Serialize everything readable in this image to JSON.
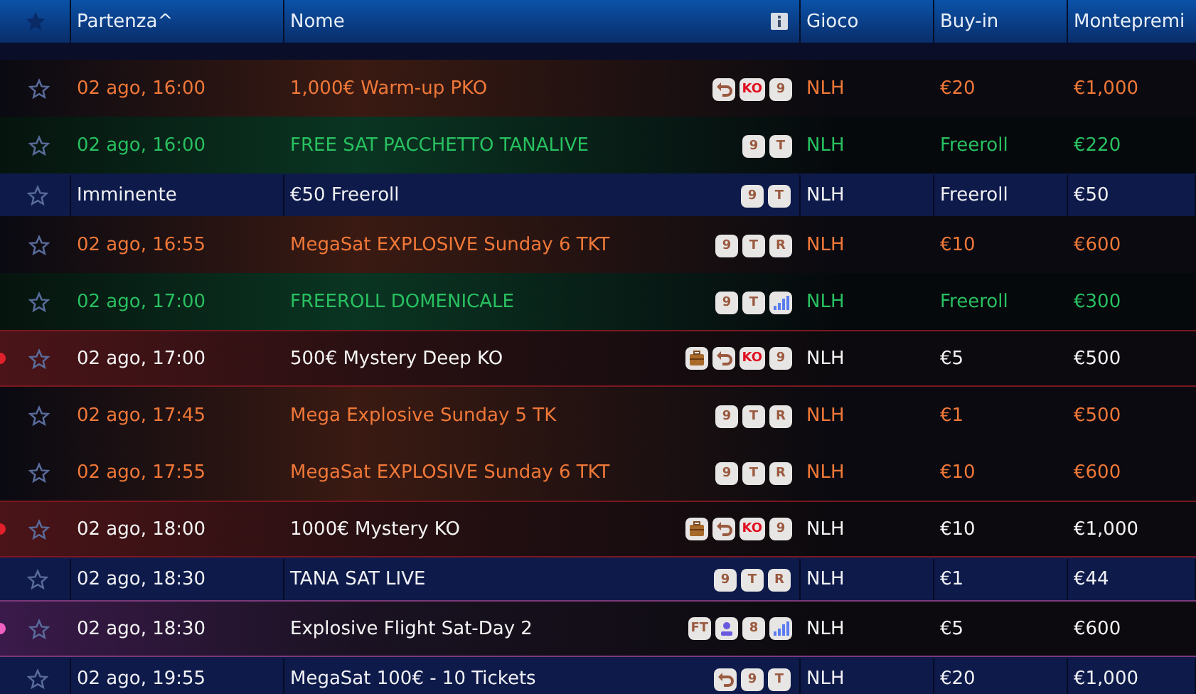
{
  "columns": [
    "Partenza^",
    "Nome",
    "Gioco",
    "Buy-in",
    "Montepremi"
  ],
  "rows": [
    {
      "kind": "orange",
      "start": "02 ago, 16:00",
      "name": "1,000€ Warm-up PKO",
      "badges": [
        {
          "kind": "rebuy"
        },
        {
          "kind": "ko",
          "label": "KO"
        },
        {
          "kind": "text",
          "label": "9"
        }
      ],
      "game": "NLH",
      "buyin": "€20",
      "prize": "€1,000"
    },
    {
      "kind": "green",
      "start": "02 ago, 16:00",
      "name": "FREE SAT PACCHETTO TANALIVE",
      "badges": [
        {
          "kind": "text",
          "label": "9"
        },
        {
          "kind": "text",
          "label": "T"
        }
      ],
      "game": "NLH",
      "buyin": "Freeroll",
      "prize": "€220"
    },
    {
      "kind": "plain",
      "start": "Imminente",
      "name": "€50 Freeroll",
      "badges": [
        {
          "kind": "text",
          "label": "9"
        },
        {
          "kind": "text",
          "label": "T"
        }
      ],
      "game": "NLH",
      "buyin": "Freeroll",
      "prize": "€50"
    },
    {
      "kind": "orange",
      "start": "02 ago, 16:55",
      "name": "MegaSat EXPLOSIVE Sunday 6 TKT",
      "badges": [
        {
          "kind": "text",
          "label": "9"
        },
        {
          "kind": "text",
          "label": "T"
        },
        {
          "kind": "text",
          "label": "R"
        }
      ],
      "game": "NLH",
      "buyin": "€10",
      "prize": "€600"
    },
    {
      "kind": "green",
      "start": "02 ago, 17:00",
      "name": "FREEROLL DOMENICALE",
      "badges": [
        {
          "kind": "text",
          "label": "9"
        },
        {
          "kind": "text",
          "label": "T"
        },
        {
          "kind": "bars"
        }
      ],
      "game": "NLH",
      "buyin": "Freeroll",
      "prize": "€300"
    },
    {
      "kind": "mystery",
      "color": "#e0202a",
      "start": "02 ago, 17:00",
      "name": "500€ Mystery Deep KO",
      "badges": [
        {
          "kind": "bag"
        },
        {
          "kind": "rebuy"
        },
        {
          "kind": "ko",
          "label": "KO"
        },
        {
          "kind": "text",
          "label": "9"
        }
      ],
      "game": "NLH",
      "buyin": "€5",
      "prize": "€500"
    },
    {
      "kind": "orange",
      "start": "02 ago, 17:45",
      "name": "Mega Explosive Sunday 5 TK",
      "badges": [
        {
          "kind": "text",
          "label": "9"
        },
        {
          "kind": "text",
          "label": "T"
        },
        {
          "kind": "text",
          "label": "R"
        }
      ],
      "game": "NLH",
      "buyin": "€1",
      "prize": "€500"
    },
    {
      "kind": "orange",
      "start": "02 ago, 17:55",
      "name": "MegaSat EXPLOSIVE Sunday 6 TKT",
      "badges": [
        {
          "kind": "text",
          "label": "9"
        },
        {
          "kind": "text",
          "label": "T"
        },
        {
          "kind": "text",
          "label": "R"
        }
      ],
      "game": "NLH",
      "buyin": "€10",
      "prize": "€600"
    },
    {
      "kind": "mystery",
      "color": "#e0202a",
      "start": "02 ago, 18:00",
      "name": "1000€ Mystery KO",
      "badges": [
        {
          "kind": "bag"
        },
        {
          "kind": "rebuy"
        },
        {
          "kind": "ko",
          "label": "KO"
        },
        {
          "kind": "text",
          "label": "9"
        }
      ],
      "game": "NLH",
      "buyin": "€10",
      "prize": "€1,000"
    },
    {
      "kind": "plain",
      "start": "02 ago, 18:30",
      "name": "TANA SAT LIVE",
      "badges": [
        {
          "kind": "text",
          "label": "9"
        },
        {
          "kind": "text",
          "label": "T"
        },
        {
          "kind": "text",
          "label": "R"
        }
      ],
      "game": "NLH",
      "buyin": "€1",
      "prize": "€44"
    },
    {
      "kind": "flight",
      "color": "#f060c0",
      "start": "02 ago, 18:30",
      "name": "Explosive Flight Sat-Day 2",
      "badges": [
        {
          "kind": "text",
          "label": "FT"
        },
        {
          "kind": "figure"
        },
        {
          "kind": "text",
          "label": "8"
        },
        {
          "kind": "bars"
        }
      ],
      "game": "NLH",
      "buyin": "€5",
      "prize": "€600"
    },
    {
      "kind": "plain",
      "start": "02 ago, 19:55",
      "name": "MegaSat 100€ - 10 Tickets",
      "badges": [
        {
          "kind": "rebuy"
        },
        {
          "kind": "text",
          "label": "9"
        },
        {
          "kind": "text",
          "label": "T"
        }
      ],
      "game": "NLH",
      "buyin": "€20",
      "prize": "€1,000"
    }
  ]
}
